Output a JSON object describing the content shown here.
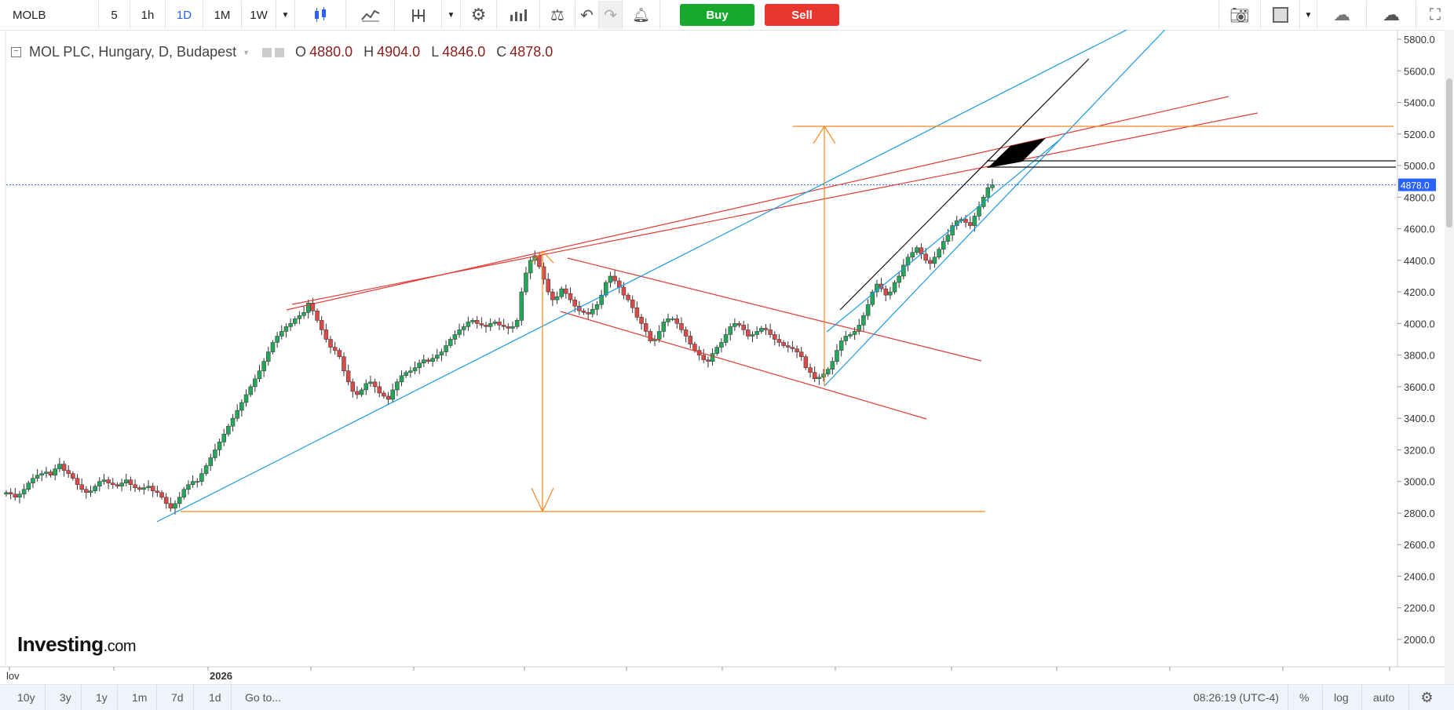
{
  "toolbar": {
    "symbol": "MOLB",
    "intervals": [
      "5",
      "1h",
      "1D",
      "1M",
      "1W"
    ],
    "active_interval": "1D",
    "buy_label": "Buy",
    "sell_label": "Sell"
  },
  "legend": {
    "name": "MOL PLC, Hungary, D, Budapest",
    "open_label": "O",
    "open": "4880.0",
    "high_label": "H",
    "high": "4904.0",
    "low_label": "L",
    "low": "4846.0",
    "close_label": "C",
    "close": "4878.0"
  },
  "price_axis": {
    "ticks": [
      "5800.0",
      "5600.0",
      "5400.0",
      "5200.0",
      "5000.0",
      "4800.0",
      "4600.0",
      "4400.0",
      "4200.0",
      "4000.0",
      "3800.0",
      "3600.0",
      "3400.0",
      "3200.0",
      "3000.0",
      "2800.0",
      "2600.0",
      "2400.0",
      "2200.0",
      "2000.0"
    ],
    "current": "4878.0"
  },
  "time_axis": {
    "labels": [
      "lov",
      "2026"
    ]
  },
  "bottombar": {
    "ranges": [
      "10y",
      "3y",
      "1y",
      "1m",
      "7d",
      "1d"
    ],
    "goto": "Go to...",
    "time": "08:26:19 (UTC-4)",
    "percent": "%",
    "log": "log",
    "auto": "auto"
  },
  "logo": {
    "main": "Investing",
    "suffix": ".com"
  },
  "colors": {
    "up": "#26a65b",
    "down": "#d94b4b",
    "trend_red": "#e53935",
    "trend_blue": "#1a9be0",
    "orange": "#f5871f",
    "price_line": "#2962ff"
  },
  "chart_data": {
    "type": "candlestick",
    "symbol": "MOLB",
    "ylim": [
      1850,
      5850
    ],
    "yticks": [
      2000,
      2200,
      2400,
      2600,
      2800,
      3000,
      3200,
      3400,
      3600,
      3800,
      4000,
      4200,
      4400,
      4600,
      4800,
      5000,
      5200,
      5400,
      5600,
      5800
    ],
    "last_price": 4878,
    "closes": [
      2930,
      2920,
      2900,
      2920,
      2950,
      2990,
      3020,
      3040,
      3050,
      3060,
      3040,
      3080,
      3110,
      3070,
      3050,
      3020,
      2980,
      2950,
      2930,
      2940,
      2970,
      3000,
      3010,
      2990,
      2980,
      2970,
      2990,
      3010,
      2980,
      2960,
      2950,
      2960,
      2970,
      2940,
      2930,
      2900,
      2860,
      2830,
      2860,
      2900,
      2950,
      2980,
      3000,
      3000,
      3050,
      3100,
      3150,
      3200,
      3250,
      3300,
      3350,
      3400,
      3450,
      3500,
      3550,
      3600,
      3650,
      3700,
      3760,
      3820,
      3880,
      3920,
      3950,
      3980,
      4000,
      4030,
      4050,
      4070,
      4130,
      4080,
      4020,
      3960,
      3900,
      3850,
      3830,
      3790,
      3700,
      3630,
      3570,
      3550,
      3580,
      3620,
      3630,
      3600,
      3560,
      3540,
      3520,
      3580,
      3630,
      3670,
      3690,
      3700,
      3720,
      3750,
      3770,
      3760,
      3780,
      3800,
      3820,
      3860,
      3900,
      3930,
      3960,
      3980,
      4010,
      4020,
      4000,
      3990,
      3980,
      4000,
      4010,
      3990,
      3980,
      3970,
      3980,
      4020,
      4200,
      4320,
      4400,
      4430,
      4360,
      4280,
      4200,
      4150,
      4170,
      4220,
      4190,
      4150,
      4110,
      4080,
      4070,
      4060,
      4090,
      4120,
      4180,
      4260,
      4300,
      4270,
      4230,
      4180,
      4150,
      4100,
      4040,
      4000,
      3950,
      3890,
      3900,
      3950,
      4010,
      4030,
      4030,
      4000,
      3960,
      3920,
      3870,
      3830,
      3800,
      3770,
      3760,
      3810,
      3850,
      3880,
      3930,
      3980,
      4000,
      3990,
      3960,
      3920,
      3930,
      3950,
      3970,
      3960,
      3930,
      3900,
      3880,
      3860,
      3850,
      3840,
      3820,
      3790,
      3720,
      3690,
      3650,
      3660,
      3680,
      3710,
      3760,
      3830,
      3890,
      3920,
      3930,
      3950,
      3990,
      4050,
      4120,
      4200,
      4250,
      4220,
      4180,
      4200,
      4260,
      4300,
      4370,
      4420,
      4450,
      4480,
      4440,
      4400,
      4380,
      4420,
      4470,
      4520,
      4560,
      4620,
      4650,
      4660,
      4640,
      4620,
      4680,
      4740,
      4800,
      4860,
      4878
    ]
  }
}
